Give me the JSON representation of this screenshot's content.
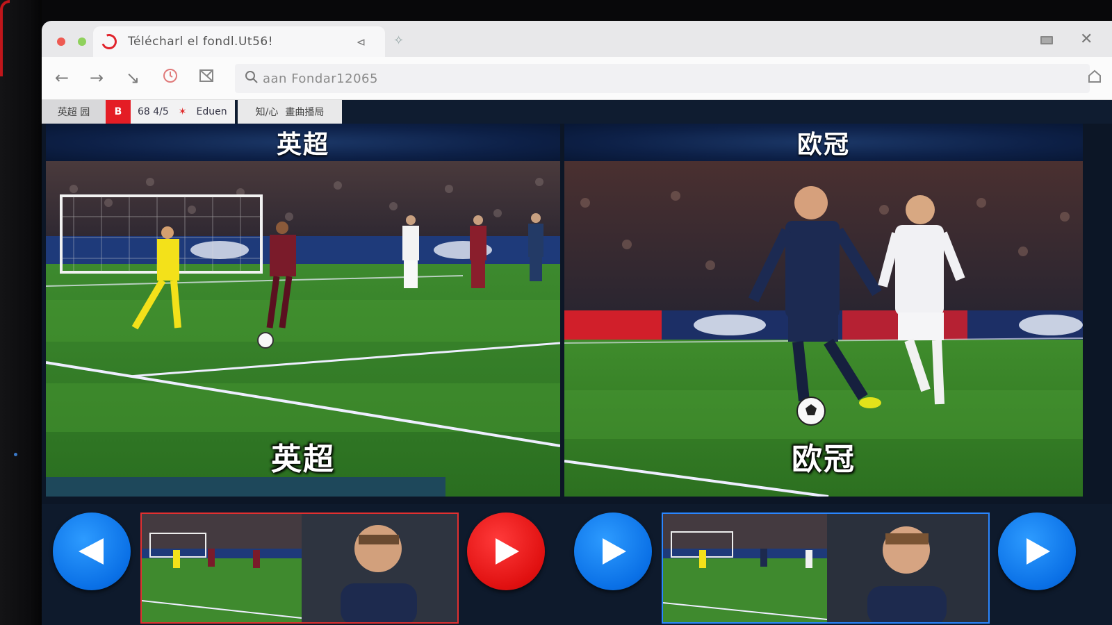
{
  "browser": {
    "tab_title": "Télécharl el fondl.Ut56!",
    "tab_close_glyph": "⊲",
    "new_tab_glyph": "✧",
    "address_text": "aan Fondar12065",
    "colors": {
      "brand_red": "#e41d25",
      "accent_blue": "#0a70e6"
    }
  },
  "bookmarks": [
    {
      "label": "英超 园"
    },
    {
      "label": "B"
    },
    {
      "label": "68 4/5",
      "extra": "Eduen"
    },
    {
      "label": "知/心",
      "extra": "畫曲播局"
    }
  ],
  "panels": {
    "left": {
      "header": "英超",
      "caption": "英超"
    },
    "right": {
      "header": "欧冠",
      "caption": "欧冠"
    }
  },
  "icons": {
    "back": "arrow-left-icon",
    "forward": "arrow-right-icon",
    "reload": "chevron-right-icon",
    "history": "clock-icon",
    "extension": "image-icon",
    "search": "search-icon",
    "home": "home-icon"
  }
}
